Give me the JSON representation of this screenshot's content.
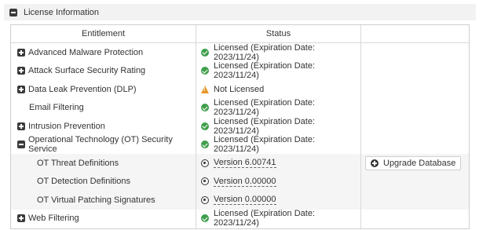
{
  "section": {
    "title": "License Information",
    "icon": "minus-box-icon"
  },
  "table": {
    "headers": {
      "entitlement": "Entitlement",
      "status": "Status"
    },
    "rows": [
      {
        "expander": "plus",
        "name": "Advanced Malware Protection",
        "status_icon": "check-circle-icon",
        "status": "Licensed (Expiration Date: 2023/11/24)"
      },
      {
        "expander": "plus",
        "name": "Attack Surface Security Rating",
        "status_icon": "check-circle-icon",
        "status": "Licensed (Expiration Date: 2023/11/24)"
      },
      {
        "expander": "plus",
        "name": "Data Leak Prevention (DLP)",
        "status_icon": "warning-icon",
        "status": "Not Licensed"
      },
      {
        "expander": "none",
        "name": "Email Filtering",
        "status_icon": "check-circle-icon",
        "status": "Licensed (Expiration Date: 2023/11/24)"
      },
      {
        "expander": "plus",
        "name": "Intrusion Prevention",
        "status_icon": "check-circle-icon",
        "status": "Licensed (Expiration Date: 2023/11/24)"
      },
      {
        "expander": "minus",
        "name": "Operational Technology (OT) Security Service",
        "status_icon": "check-circle-icon",
        "status": "Licensed (Expiration Date: 2023/11/24)"
      },
      {
        "expander": "child",
        "name": "OT Threat Definitions",
        "status_icon": "radio-icon",
        "status": "Version 6.00741"
      },
      {
        "expander": "child",
        "name": "OT Detection Definitions",
        "status_icon": "radio-icon",
        "status": "Version 0.00000"
      },
      {
        "expander": "child",
        "name": "OT Virtual Patching Signatures",
        "status_icon": "radio-icon",
        "status": "Version 0.00000"
      },
      {
        "expander": "plus",
        "name": "Web Filtering",
        "status_icon": "check-circle-icon",
        "status": "Licensed (Expiration Date: 2023/11/24)"
      }
    ]
  },
  "actions": {
    "upgrade_database": "Upgrade Database",
    "upgrade_icon": "plus-circle-icon"
  },
  "colors": {
    "ok": "#3f9e4b",
    "warning": "#e8962a",
    "header_bg": "#f2f2f2",
    "child_bg": "#f5f5f5"
  }
}
